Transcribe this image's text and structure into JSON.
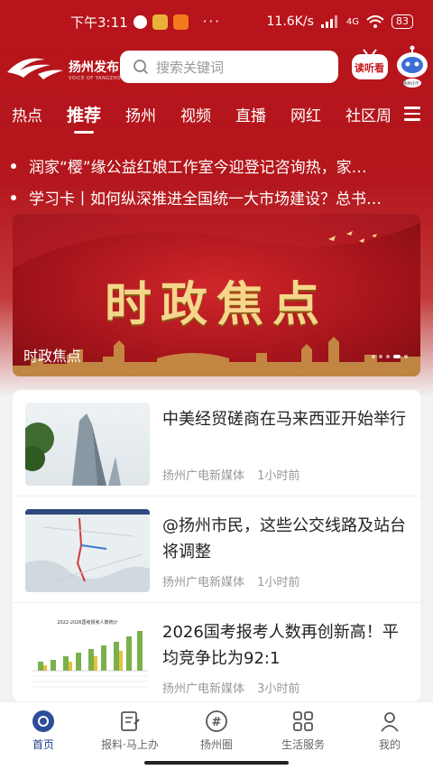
{
  "status_bar": {
    "time": "下午3:11",
    "network_speed": "11.6K/s",
    "network_type": "4G",
    "battery": "83",
    "icons": [
      "app-notify-icon",
      "weibo-icon",
      "taobao-icon",
      "more-dots-icon",
      "signal-icon",
      "wifi-icon"
    ]
  },
  "header": {
    "logo_text": "扬州发布",
    "logo_sub": "VOICE OF YANGZHOU",
    "search_placeholder": "搜索关键词",
    "read_label": "读听看",
    "robot_label": "扬州小Y"
  },
  "tabs": [
    "热点",
    "推荐",
    "扬州",
    "视频",
    "直播",
    "网红",
    "社区周"
  ],
  "active_tab": "推荐",
  "ticker": [
    "润家“樱”缘公益红娘工作室今迎登记咨询热，家…",
    "学习卡丨如何纵深推进全国统一大市场建设？总书…"
  ],
  "banner": {
    "title": "时政焦点",
    "caption": "时政焦点",
    "dot_count": 5,
    "active_dot": 4
  },
  "news": [
    {
      "title": "中美经贸磋商在马来西亚开始举行",
      "source": "扬州广电新媒体",
      "time": "1小时前",
      "thumb": "building-photo"
    },
    {
      "title": "@扬州市民，这些公交线路及站台将调整",
      "source": "扬州广电新媒体",
      "time": "1小时前",
      "thumb": "map-photo"
    },
    {
      "title": "2026国考报考人数再创新高！平均竞争比为92:1",
      "source": "扬州广电新媒体",
      "time": "3小时前",
      "thumb": "chart-photo",
      "thumb_caption": "2022-2026国考报考人数统计"
    }
  ],
  "bottom_nav": [
    {
      "label": "首页",
      "icon": "home-icon",
      "active": true
    },
    {
      "label": "报料·马上办",
      "icon": "report-icon",
      "active": false
    },
    {
      "label": "扬州圈",
      "icon": "hashtag-icon",
      "active": false
    },
    {
      "label": "生活服务",
      "icon": "grid-icon",
      "active": false
    },
    {
      "label": "我的",
      "icon": "user-icon",
      "active": false
    }
  ],
  "colors": {
    "brand_red": "#b8141b",
    "gold": "#f5d68b",
    "nav_active": "#1f3f8a"
  }
}
